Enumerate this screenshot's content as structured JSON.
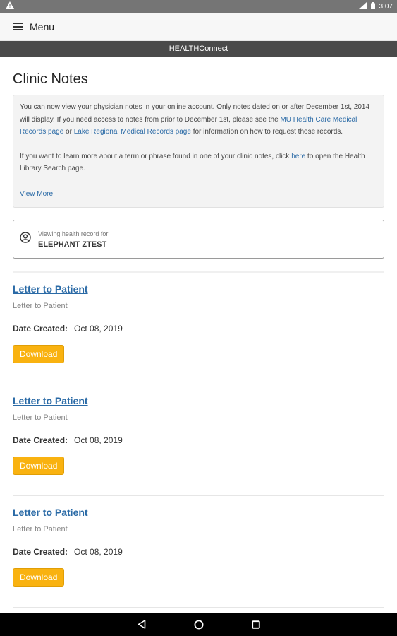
{
  "status_bar": {
    "time": "3:07"
  },
  "header": {
    "menu_label": "Menu"
  },
  "brand": {
    "name": "HEALTHConnect"
  },
  "page": {
    "title": "Clinic Notes"
  },
  "info": {
    "p1_a": "You can now view your physician notes in your online account.  Only notes dated on or after December 1st, 2014 will display.  If you need access to notes from prior to December 1st, please see the ",
    "p1_link1": "MU Health Care Medical Records page",
    "p1_or": " or ",
    "p1_link2": "Lake Regional Medical Records page",
    "p1_b": " for information on how to request those records.",
    "p2_a": "If you want to learn more about a term or phrase found in one of your clinic notes, click ",
    "p2_link": "here",
    "p2_b": " to open the Health Library Search page.",
    "view_more": "View More"
  },
  "record": {
    "caption": "Viewing health record for",
    "name": "ELEPHANT ZTEST"
  },
  "notes": [
    {
      "title": "Letter to Patient",
      "subtitle": "Letter to Patient",
      "date_label": "Date Created:",
      "date": "Oct 08, 2019",
      "button": "Download"
    },
    {
      "title": "Letter to Patient",
      "subtitle": "Letter to Patient",
      "date_label": "Date Created:",
      "date": "Oct 08, 2019",
      "button": "Download"
    },
    {
      "title": "Letter to Patient",
      "subtitle": "Letter to Patient",
      "date_label": "Date Created:",
      "date": "Oct 08, 2019",
      "button": "Download"
    }
  ],
  "colors": {
    "accent": "#2a6aa6",
    "button": "#f9b210",
    "brand_bar": "#4a4a4a"
  },
  "icons": {
    "warning": "warning-icon",
    "signal": "signal-icon",
    "battery": "battery-icon",
    "menu": "hamburger-icon",
    "person": "person-icon",
    "back": "back-icon",
    "home": "home-icon",
    "recents": "recents-icon"
  }
}
